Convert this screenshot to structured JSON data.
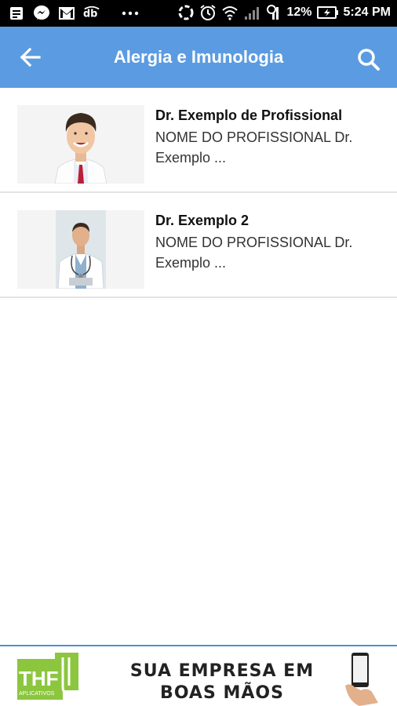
{
  "status_bar": {
    "battery": "12%",
    "time": "5:24 PM",
    "icons_left": [
      "notes-icon",
      "messenger-icon",
      "gmail-icon",
      "dab-icon",
      "more-icon"
    ],
    "icons_right": [
      "sync-icon",
      "alarm-icon",
      "wifi-icon",
      "signal-icon",
      "data-icon",
      "battery-icon"
    ]
  },
  "appbar": {
    "title": "Alergia e Imunologia",
    "back_icon": "back-arrow-icon",
    "search_icon": "search-icon",
    "color": "#5b9be1"
  },
  "professionals": [
    {
      "name": "Dr. Exemplo de Profissional",
      "description": "NOME DO PROFISSIONAL Dr. Exemplo ..."
    },
    {
      "name": "Dr. Exemplo 2",
      "description": "NOME DO PROFISSIONAL Dr. Exemplo ..."
    }
  ],
  "banner": {
    "logo_text": "THF",
    "logo_subtext": "APLICATIVOS",
    "line1": "SUA EMPRESA EM",
    "line2": "BOAS MÃOS",
    "accent": "#8cc63f"
  }
}
